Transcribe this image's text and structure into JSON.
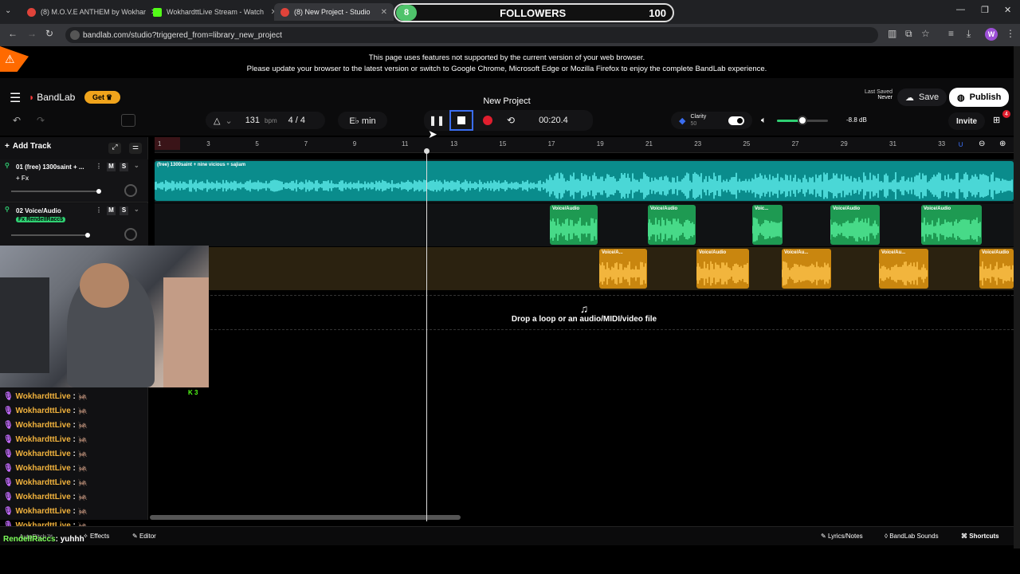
{
  "browser": {
    "tabs": [
      {
        "title": "(8) M.O.V.E ANTHEM by Wokhar",
        "color": "#e0433a"
      },
      {
        "title": "WokhardttLive Stream - Watch",
        "color": "#53fc18"
      },
      {
        "title": "(8) New Project - Studio",
        "color": "#e0433a"
      }
    ],
    "url": "bandlab.com/studio?triggered_from=library_new_project",
    "profile_initial": "W"
  },
  "overlay": {
    "count": "8",
    "label": "FOLLOWERS",
    "goal": "100"
  },
  "banner": {
    "line1": "This page uses features not supported by the current version of your web browser.",
    "line2": "Please update your browser to the latest version or switch to Google Chrome, Microsoft Edge or Mozilla Firefox to enjoy the complete BandLab experience."
  },
  "studio": {
    "brand": "BandLab",
    "get_label": "Get",
    "project_title": "New Project",
    "last_saved_label": "Last Saved",
    "last_saved_value": "Never",
    "save_label": "Save",
    "publish_label": "Publish",
    "invite_label": "Invite",
    "notif_count": "4",
    "bpm": "131",
    "bpm_unit": "bpm",
    "time_sig": "4 / 4",
    "key": "E♭ min",
    "time": "00:20.4",
    "clarity_label": "Clarity",
    "clarity_value": "50",
    "volume_db": "-8.8 dB",
    "volume_level": 0.5,
    "add_track_label": "Add Track",
    "ruler_marks": [
      "1",
      "3",
      "5",
      "7",
      "9",
      "11",
      "13",
      "15",
      "17",
      "19",
      "21",
      "23",
      "25",
      "27",
      "29",
      "31",
      "33"
    ],
    "drop_text": "Drop a loop or an audio/MIDI/video file",
    "colors": {
      "teal": "#16c2c2",
      "green": "#2fcf72",
      "orange": "#f0a41c",
      "accent": "#ff3b3b"
    }
  },
  "tracks": [
    {
      "name": "01  (free) 1300saint + ...",
      "sub": "+ Fx",
      "m": "M",
      "s": "S"
    },
    {
      "name": "02  Voice/Audio",
      "sub": "Fx RendellRacc$",
      "m": "M",
      "s": "S"
    }
  ],
  "clips": {
    "track1_label": "(free) 1300saint + nine vicious + sajiam",
    "green": [
      "Voice/Audio",
      "Voice/Audio",
      "Voic...",
      "Voice/Audio",
      "Voice/Audio"
    ],
    "orange": [
      "Voice/A...",
      "Voice/Audio",
      "Voice/Au...",
      "Voice/Au...",
      "Voice/Audio"
    ]
  },
  "chat": {
    "lines": [
      {
        "user": "WokhardttLive",
        "msg": "🦗"
      },
      {
        "user": "WokhardttLive",
        "msg": "🦗"
      },
      {
        "user": "WokhardttLive",
        "msg": "🦗"
      },
      {
        "user": "WokhardttLive",
        "msg": "🦗"
      },
      {
        "user": "WokhardttLive",
        "msg": "🦗"
      },
      {
        "user": "WokhardttLive",
        "msg": "🦗"
      },
      {
        "user": "WokhardttLive",
        "msg": "🦗"
      },
      {
        "user": "WokhardttLive",
        "msg": "🦗"
      },
      {
        "user": "WokhardttLive",
        "msg": "🦗"
      },
      {
        "user": "WokhardttLive",
        "msg": "🦗"
      }
    ],
    "last_user": "RendellRaccs",
    "last_msg": "yuhhh",
    "viewer_count": "3"
  },
  "bottombar": {
    "autopitch": "AutoPitch™",
    "effects": "Effects",
    "editor": "Editor",
    "lyrics": "Lyrics/Notes",
    "sounds": "BandLab Sounds",
    "shortcuts": "Shortcuts"
  }
}
